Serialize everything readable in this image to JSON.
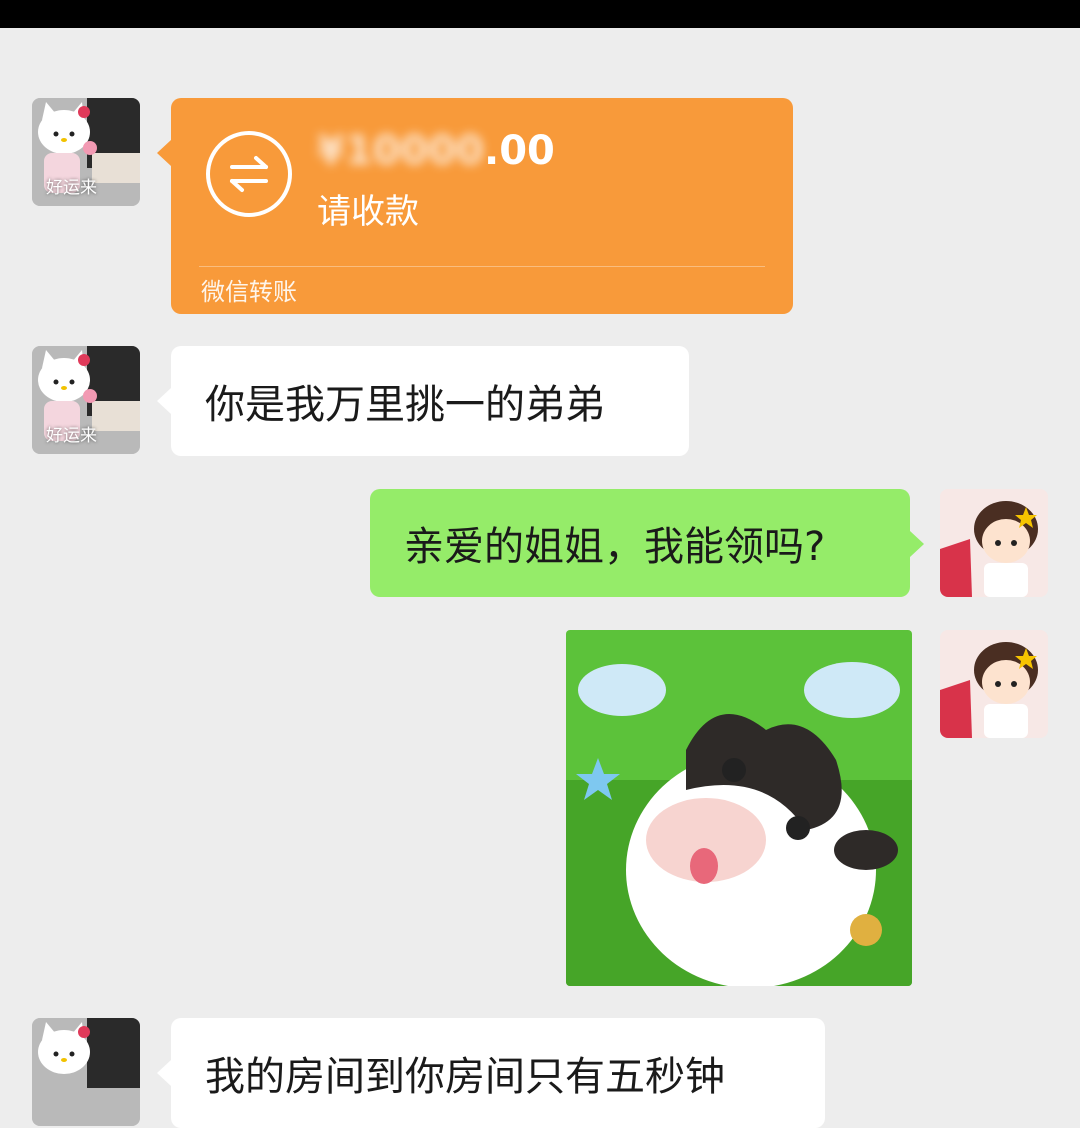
{
  "transfer": {
    "amount_hidden": "¥10000",
    "amount_visible": ".00",
    "status": "请收款",
    "footer": "微信转账"
  },
  "left_avatar": {
    "caption": "好运来"
  },
  "messages": [
    {
      "side": "left",
      "text": "你是我万里挑一的弟弟"
    },
    {
      "side": "right",
      "text": "亲爱的姐姐，我能领吗?"
    },
    {
      "side": "left",
      "text": "我的房间到你房间只有五秒钟"
    }
  ],
  "colors": {
    "transfer_orange": "#f89a3a",
    "green_bubble": "#95ec69",
    "background": "#ededed"
  }
}
